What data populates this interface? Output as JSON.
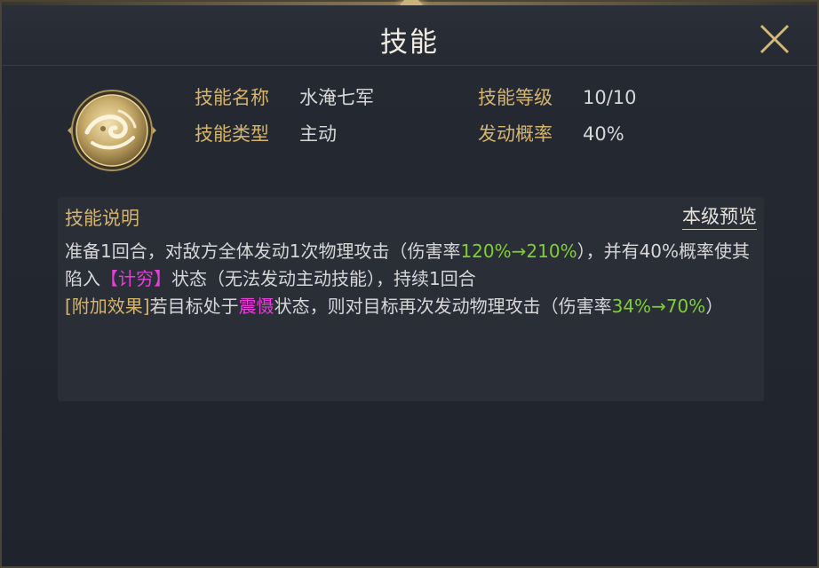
{
  "dialog": {
    "title": "技能",
    "close_icon": "close-x-icon"
  },
  "skill": {
    "icon": "water-wave-skill-icon",
    "name_label": "技能名称",
    "name_value": "水淹七军",
    "type_label": "技能类型",
    "type_value": "主动",
    "level_label": "技能等级",
    "level_value": "10/10",
    "chance_label": "发动概率",
    "chance_value": "40%"
  },
  "description": {
    "title": "技能说明",
    "preview_link": "本级预览",
    "line1_a": "准备1回合，对敌方全体发动1次物理攻击（伤害率",
    "line1_b": "120%→210%",
    "line1_c": "），并有40%概率使其陷入",
    "status1": "【计穷】",
    "line1_d": "状态（无法发动主动技能），持续1回合",
    "extra_tag": "[附加效果]",
    "line2_a": "若目标处于",
    "status2": "震慑",
    "line2_b": "状态，则对目标再次发动物理攻击（伤害率",
    "line2_c": "34%→70%",
    "line2_d": "）"
  },
  "colors": {
    "accent_gold": "#d5b46e",
    "highlight_green": "#7fcf32",
    "status_magenta": "#e43fd6"
  }
}
